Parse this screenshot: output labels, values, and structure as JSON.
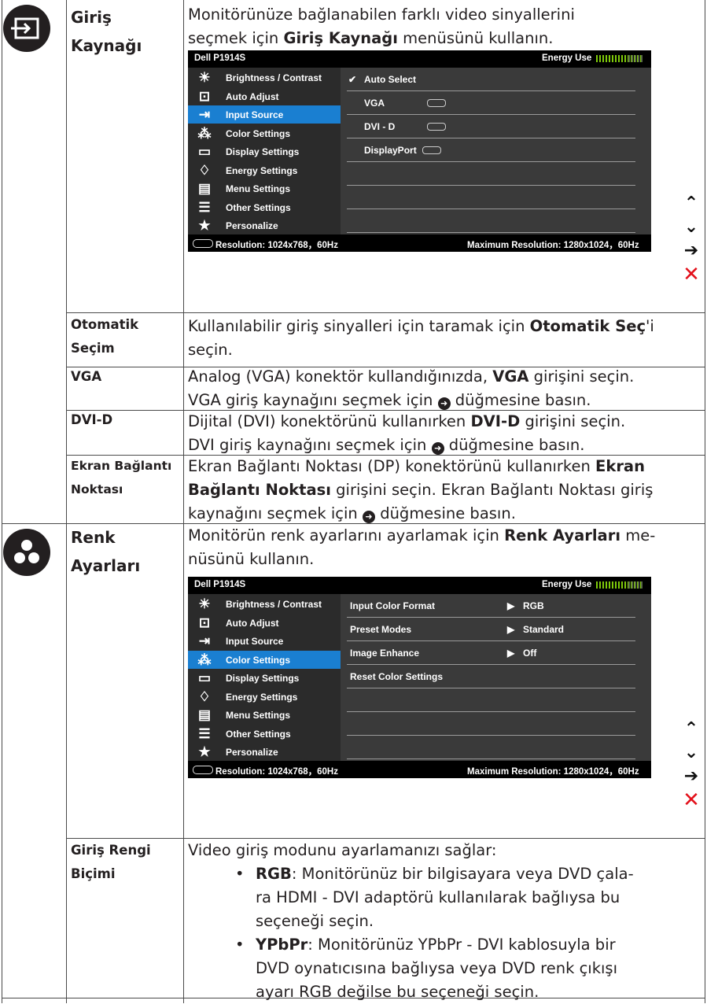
{
  "section_input": {
    "title_line1": "Giriş",
    "title_line2": "Kaynağı",
    "desc_line1": "Monitörünüze bağlanabilen farklı video sinyallerini",
    "desc_line2_pre": "seçmek için ",
    "desc_line2_bold": "Giriş Kaynağı",
    "desc_line2_post": " menüsünü kullanın."
  },
  "osd_common": {
    "model": "Dell P1914S",
    "energy_label": "Energy Use",
    "resolution": "Resolution: 1024x768，60Hz",
    "max_resolution": "Maximum Resolution: 1280x1024，60Hz",
    "menu": [
      {
        "label": "Brightness / Contrast",
        "icon": "brightness-icon"
      },
      {
        "label": "Auto Adjust",
        "icon": "auto-adjust-icon"
      },
      {
        "label": "Input Source",
        "icon": "input-source-icon"
      },
      {
        "label": "Color Settings",
        "icon": "color-settings-icon"
      },
      {
        "label": "Display Settings",
        "icon": "display-settings-icon"
      },
      {
        "label": "Energy Settings",
        "icon": "energy-settings-icon"
      },
      {
        "label": "Menu Settings",
        "icon": "menu-settings-icon"
      },
      {
        "label": "Other Settings",
        "icon": "other-settings-icon"
      },
      {
        "label": "Personalize",
        "icon": "personalize-icon"
      }
    ]
  },
  "osd_input": {
    "options": [
      "Auto Select",
      "VGA",
      "DVI - D",
      "DisplayPort"
    ]
  },
  "osd_color": {
    "rows": [
      {
        "name": "Input Color Format",
        "value": "RGB"
      },
      {
        "name": "Preset Modes",
        "value": "Standard"
      },
      {
        "name": "Image Enhance",
        "value": "Off"
      },
      {
        "name": "Reset Color Settings",
        "value": ""
      }
    ]
  },
  "rows": {
    "auto_term_1": "Otomatik",
    "auto_term_2": "Seçim",
    "auto_desc_pre": "Kullanılabilir giriş sinyalleri için taramak için ",
    "auto_desc_bold": "Otomatik Seç",
    "auto_desc_post": "'i",
    "auto_desc_line2": "seçin.",
    "vga_term": "VGA",
    "vga_desc1_pre": "Analog (VGA) konektör kullandığınızda, ",
    "vga_desc1_bold": "VGA",
    "vga_desc1_post": " girişini seçin.",
    "vga_desc2_pre": "VGA giriş kaynağını seçmek için ",
    "vga_desc2_post": " düğmesine basın.",
    "dvi_term": "DVI-D",
    "dvi_desc1_pre": "Dijital (DVI) konektörünü kullanırken ",
    "dvi_desc1_bold": "DVI-D",
    "dvi_desc1_post": " girişini seçin.",
    "dvi_desc2_pre": "DVI giriş kaynağını seçmek için ",
    "dvi_desc2_post": " düğmesine basın.",
    "dp_term_1": "Ekran Bağlantı",
    "dp_term_2": "Noktası",
    "dp_desc1_pre": "Ekran Bağlantı Noktası (DP) konektörünü kullanırken ",
    "dp_desc1_bold": "Ekran",
    "dp_desc2_bold": "Bağlantı Noktası",
    "dp_desc2_post": " girişini seçin. Ekran Bağlantı Noktası giriş",
    "dp_desc3_pre": "kaynağını seçmek için ",
    "dp_desc3_post": " düğmesine basın."
  },
  "section_color": {
    "title_line1": "Renk",
    "title_line2": "Ayarları",
    "desc_line1_pre": "Monitörün renk ayarlarını ayarlamak için ",
    "desc_line1_bold": "Renk Ayarları",
    "desc_line1_post": " me-",
    "desc_line2": "nüsünü kullanın."
  },
  "input_color_format": {
    "term_1": "Giriş Rengi",
    "term_2": "Biçimi",
    "intro": "Video giriş modunu ayarlamanızı sağlar:",
    "b1_bold": "RGB",
    "b1_l1": ": Monitörünüz bir bilgisayara veya DVD çala-",
    "b1_l2": "ra HDMI - DVI adaptörü kullanılarak bağlıysa bu",
    "b1_l3": "seçeneği seçin.",
    "b2_bold": "YPbPr",
    "b2_l1": ": Monitörünüz YPbPr - DVI kablosuyla bir",
    "b2_l2": "DVD oynatıcısına bağlıysa veya DVD renk çıkışı",
    "b2_l3": "ayarı RGB değilse bu seçeneği seçin.",
    "bullet": "•"
  },
  "nav_buttons": [
    "up",
    "down",
    "right",
    "close"
  ],
  "colors": {
    "accent": "#1a7fd1",
    "text": "#231f20",
    "close": "#e3101a",
    "energy": "#7ec90a"
  }
}
